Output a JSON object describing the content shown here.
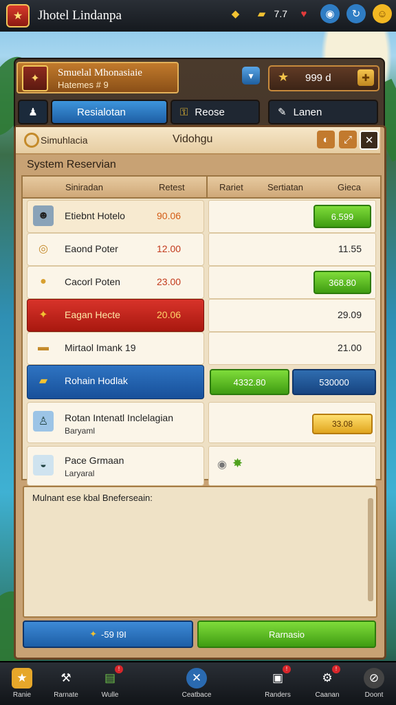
{
  "app": {
    "title": "Jhotel Lindanpa"
  },
  "topbar": {
    "counter": "7.7"
  },
  "header": {
    "profile_name": "Smuelal Mhonasiaie",
    "profile_sub": "Hatemes # 9",
    "gold_value": "999 d"
  },
  "tabs": [
    {
      "label": "Resialotan"
    },
    {
      "label": "Reose"
    },
    {
      "label": "Lanen"
    }
  ],
  "dialog": {
    "left_title": "Simuhlacia",
    "center_title": "Vidohgu",
    "subtitle": "System Reservian",
    "columns": [
      "Siniradan",
      "Retest",
      "Rariet",
      "Sertiatan",
      "Gieca"
    ]
  },
  "rows": [
    {
      "name": "Etiebnt Hotelo",
      "price": "90.06",
      "right_button": "6.599"
    },
    {
      "name": "Eaond Poter",
      "price": "12.00",
      "right_value": "11.55"
    },
    {
      "name": "Cacorl Poten",
      "price": "23.00",
      "right_button": "368.80"
    },
    {
      "name": "Eagan Hecte",
      "price": "20.06",
      "right_value": "29.09"
    },
    {
      "name": "Mirtaol Imank 19",
      "right_value": "21.00"
    },
    {
      "name": "Rohain Hodlak",
      "right_button_a": "4332.80",
      "right_button_b": "530000"
    },
    {
      "name": "Rotan Intenatl Inclelagian",
      "sub": "Baryaml",
      "right_button": "33.08"
    },
    {
      "name": "Pace Grmaan",
      "sub": "Laryaral"
    }
  ],
  "notes": {
    "label": "Mulnant ese kbal Bneferseain:"
  },
  "footer": {
    "left_button": "-59 I9I",
    "right_button": "Rarnasio"
  },
  "nav": [
    {
      "label": "Ranie"
    },
    {
      "label": "Rarnate"
    },
    {
      "label": "Wulle"
    },
    {
      "label": "Ceatbace"
    },
    {
      "label": "Randers"
    },
    {
      "label": "Caanan"
    },
    {
      "label": "Doont"
    }
  ],
  "colors": {
    "accent_blue": "#1e5ea4",
    "accent_green": "#4fb11c",
    "row_red": "#c8251b",
    "panel_tan": "#c8a274"
  }
}
